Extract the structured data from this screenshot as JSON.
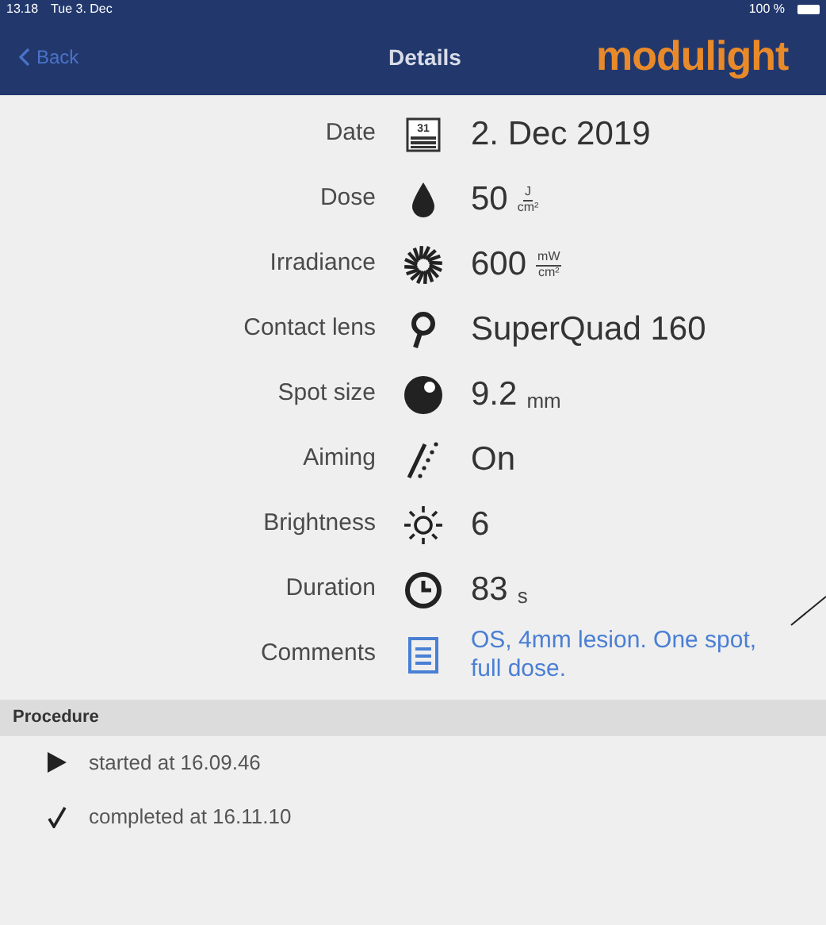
{
  "status_bar": {
    "time": "13.18",
    "date": "Tue 3. Dec",
    "battery": "100 %"
  },
  "nav_bar": {
    "back": "Back",
    "title": "Details",
    "logo": "modulight"
  },
  "details": [
    {
      "label": "Date",
      "kind": "plain",
      "value": "2. Dec 2019",
      "icon_label": "31"
    },
    {
      "label": "Dose",
      "kind": "fraction",
      "value": "50",
      "unit_top": "J",
      "unit_bottom": "cm²"
    },
    {
      "label": "Irradiance",
      "kind": "fraction",
      "value": "600",
      "unit_top": "mW",
      "unit_bottom": "cm²"
    },
    {
      "label": "Contact lens",
      "kind": "plain",
      "value": "SuperQuad 160"
    },
    {
      "label": "Spot size",
      "kind": "unit",
      "value": "9.2",
      "unit": "mm"
    },
    {
      "label": "Aiming",
      "kind": "plain",
      "value": "On"
    },
    {
      "label": "Brightness",
      "kind": "plain",
      "value": "6"
    },
    {
      "label": "Duration",
      "kind": "unit",
      "value": "83",
      "unit": "s"
    },
    {
      "label": "Comments",
      "kind": "link",
      "value": "OS, 4mm lesion. One spot, full dose."
    }
  ],
  "procedure": {
    "title": "Procedure",
    "items": [
      {
        "kind": "started",
        "text": "started at 16.09.46"
      },
      {
        "kind": "completed",
        "text": "completed at 16.11.10"
      }
    ]
  }
}
